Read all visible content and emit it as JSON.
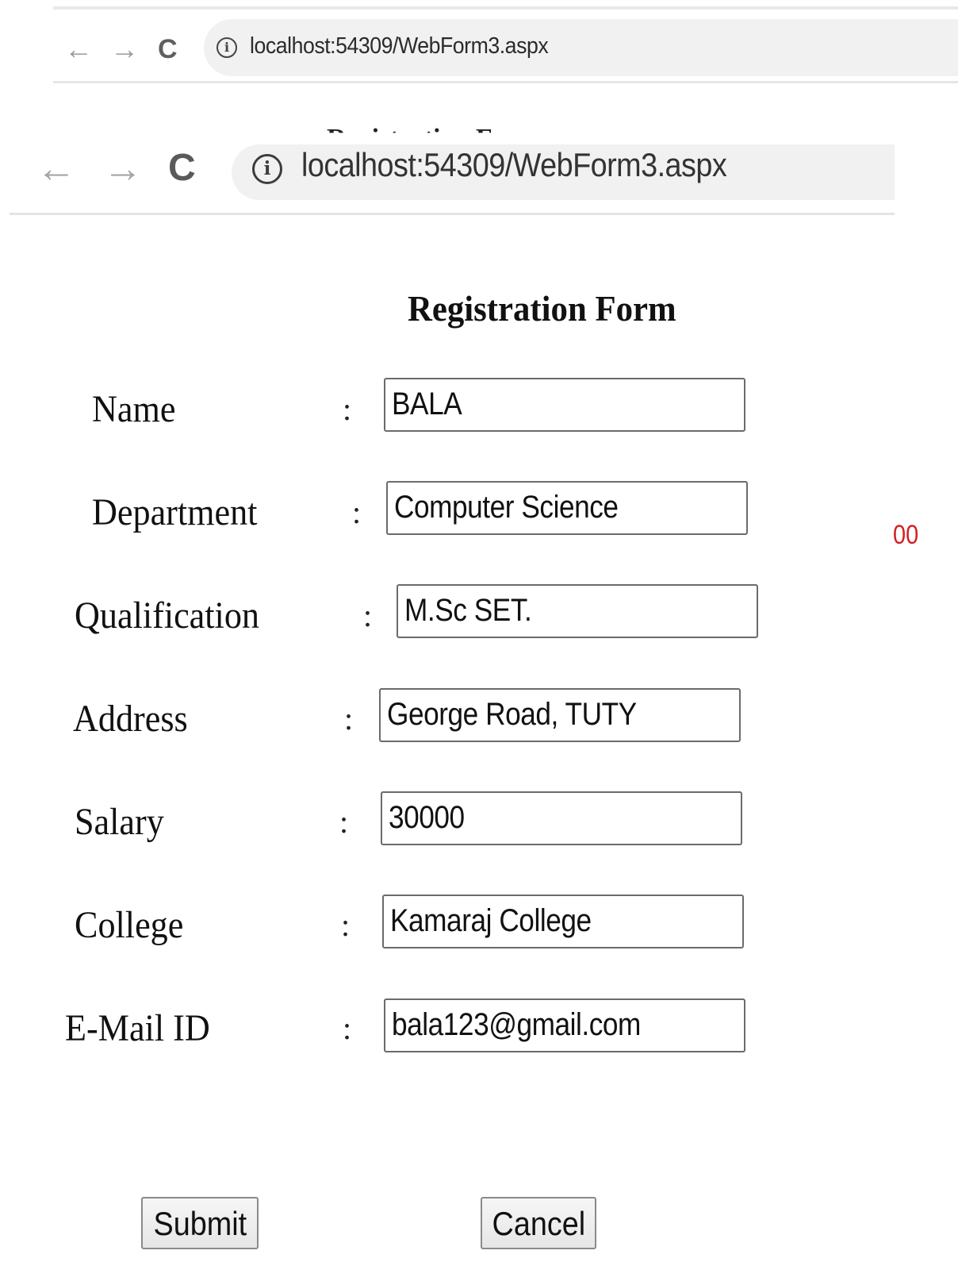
{
  "browser_top": {
    "url": "localhost:54309/WebForm3.aspx"
  },
  "browser_front": {
    "url": "localhost:54309/WebForm3.aspx"
  },
  "form": {
    "title": "Registration Form",
    "colon": ":",
    "fields": [
      {
        "label": "Name",
        "value": "BALA"
      },
      {
        "label": "Department",
        "value": "Computer Science"
      },
      {
        "label": "Qualification",
        "value": "M.Sc SET."
      },
      {
        "label": "Address",
        "value": "George Road, TUTY"
      },
      {
        "label": "Salary",
        "value": "30000"
      },
      {
        "label": "College",
        "value": "Kamaraj College"
      },
      {
        "label": "E-Mail ID",
        "value": "bala123@gmail.com"
      }
    ],
    "stray_text": "00",
    "submit_label": "Submit",
    "cancel_label": "Cancel"
  },
  "icons": {
    "back": "back-arrow-icon",
    "forward": "forward-arrow-icon",
    "reload": "reload-icon",
    "info": "info-icon"
  },
  "colors": {
    "stray_text": "#d22222",
    "url_bar": "#f1f1f1"
  }
}
